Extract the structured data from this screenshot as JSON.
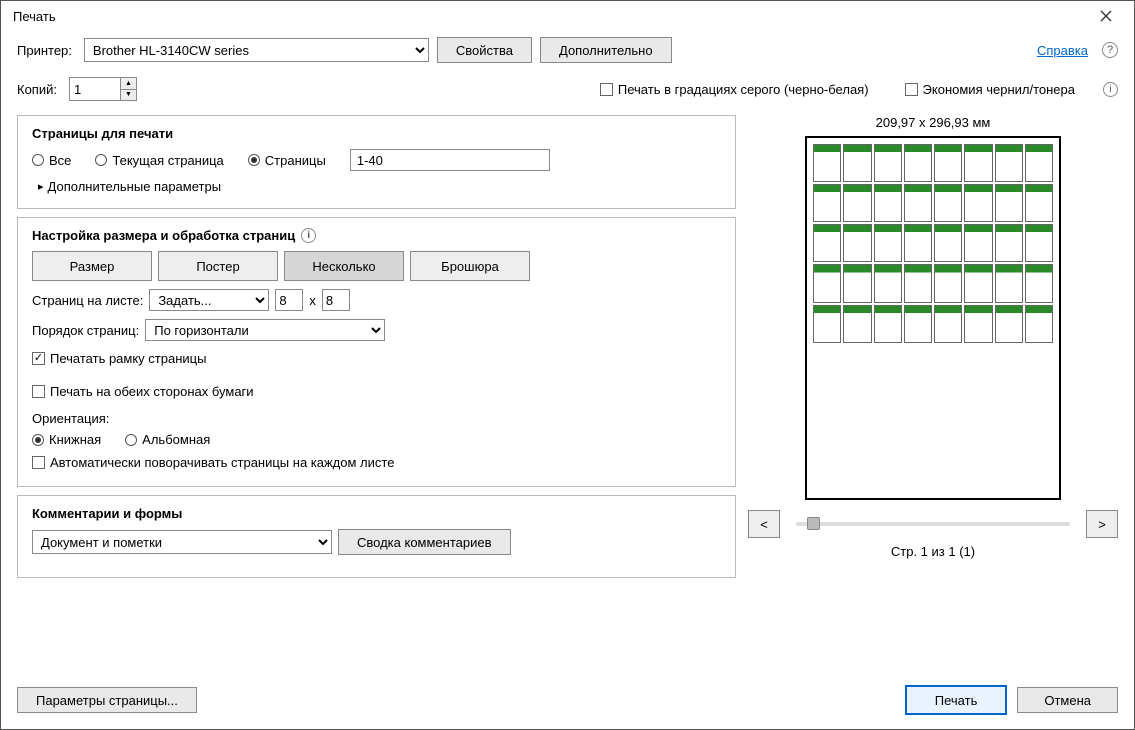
{
  "window": {
    "title": "Печать"
  },
  "toprow": {
    "printer_label": "Принтер:",
    "printer_selected": "Brother HL-3140CW series",
    "properties_btn": "Свойства",
    "advanced_btn": "Дополнительно",
    "help_link": "Справка"
  },
  "row2": {
    "copies_label": "Копий:",
    "copies_value": "1",
    "grayscale_label": "Печать в градациях серого (черно-белая)",
    "ink_save_label": "Экономия чернил/тонера"
  },
  "pages_panel": {
    "title": "Страницы для печати",
    "r_all": "Все",
    "r_current": "Текущая страница",
    "r_pages": "Страницы",
    "pages_value": "1-40",
    "more_options": "Дополнительные параметры"
  },
  "size_panel": {
    "title": "Настройка размера и обработка страниц",
    "tab_size": "Размер",
    "tab_poster": "Постер",
    "tab_multiple": "Несколько",
    "tab_booklet": "Брошюра",
    "per_sheet_label": "Страниц на листе:",
    "per_sheet_mode": "Задать...",
    "per_sheet_x": "8",
    "per_sheet_mult": "x",
    "per_sheet_y": "8",
    "order_label": "Порядок страниц:",
    "order_value": "По горизонтали",
    "frame_label": "Печатать рамку страницы",
    "duplex_label": "Печать на обеих сторонах бумаги",
    "orientation_label": "Ориентация:",
    "orient_portrait": "Книжная",
    "orient_landscape": "Альбомная",
    "autorotate_label": "Автоматически поворачивать страницы на каждом листе"
  },
  "comments_panel": {
    "title": "Комментарии и формы",
    "selected": "Документ и пометки",
    "summary_btn": "Сводка комментариев"
  },
  "preview": {
    "dimensions": "209,97 x 296,93 мм",
    "prev_btn": "<",
    "next_btn": ">",
    "page_indicator": "Стр. 1 из 1 (1)",
    "thumb_count": 40
  },
  "footer": {
    "page_setup_btn": "Параметры страницы...",
    "print_btn": "Печать",
    "cancel_btn": "Отмена"
  }
}
